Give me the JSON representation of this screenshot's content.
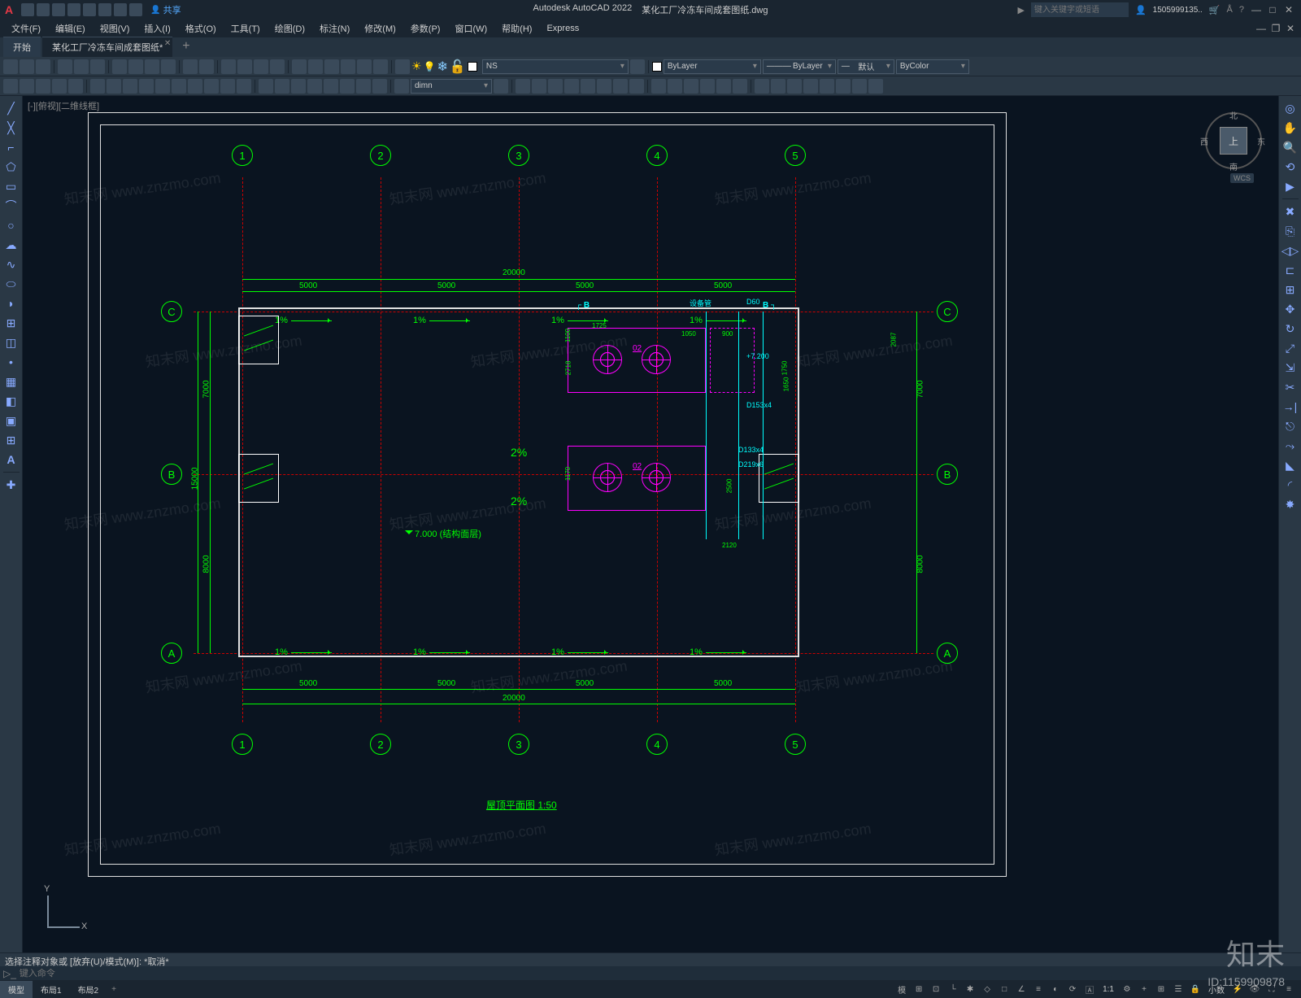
{
  "title_bar": {
    "app_name": "Autodesk AutoCAD 2022",
    "file_name": "某化工厂冷冻车间成套图纸.dwg",
    "search_placeholder": "键入关键字或短语",
    "user": "1505999135..",
    "share": "共享"
  },
  "menu": {
    "items": [
      "文件(F)",
      "编辑(E)",
      "视图(V)",
      "插入(I)",
      "格式(O)",
      "工具(T)",
      "绘图(D)",
      "标注(N)",
      "修改(M)",
      "参数(P)",
      "窗口(W)",
      "帮助(H)",
      "Express"
    ]
  },
  "doc_tabs": {
    "start": "开始",
    "active": "某化工厂冷冻车间成套图纸*"
  },
  "layer_panel": {
    "current_layer": "NS",
    "color": "ByLayer",
    "linetype": "ByLayer",
    "lineweight": "默认",
    "plotcolor": "ByColor"
  },
  "style_panel": {
    "dim_style": "dimn"
  },
  "viewport_label": "[-][俯视][二维线框]",
  "viewcube": {
    "top": "上",
    "n": "北",
    "s": "南",
    "e": "东",
    "w": "西",
    "wcs": "WCS"
  },
  "ucs": {
    "x": "X",
    "y": "Y"
  },
  "drawing": {
    "grid_cols": [
      "1",
      "2",
      "3",
      "4",
      "5"
    ],
    "grid_rows": [
      "A",
      "B",
      "C"
    ],
    "dim_h_top": [
      "5000",
      "5000",
      "5000",
      "5000"
    ],
    "dim_h_top_total": "20000",
    "dim_h_bot": [
      "5000",
      "5000",
      "5000",
      "5000"
    ],
    "dim_h_bot_total": "20000",
    "dim_v_left": [
      "7000",
      "8000"
    ],
    "dim_v_left_total": "15000",
    "dim_v_right": [
      "7000",
      "8000"
    ],
    "slope_top_pct": "1%",
    "slope_bot_pct": "1%",
    "slope_center_pct": "2%",
    "elevation": "7.000 (结构面层)",
    "equip_label": "02",
    "equip_elev": "+7.200",
    "section_b": "B",
    "detail_dim1": "1725",
    "detail_dim2": "2718",
    "detail_dim3": "1100",
    "detail_dim4": "2087",
    "detail_dim5": "2500",
    "detail_dim6": "1650",
    "detail_dim7": "1170",
    "detail_dim8": "900",
    "detail_dim9": "1050",
    "detail_dim10": "1750",
    "detail_dim11": "2120",
    "cyan_note1": "设备管",
    "cyan_note2": "D60",
    "cyan_note3": "D153x4",
    "cyan_note4": "D133x4",
    "cyan_note5": "D219x6",
    "title": "屋顶平面图 1:50"
  },
  "command": {
    "history": "选择注释对象或  [放弃(U)/模式(M)]:  *取消*",
    "placeholder": "键入命令"
  },
  "status": {
    "tabs": [
      "模型",
      "布局1",
      "布局2"
    ],
    "scale": "1:1",
    "right_text": "小数"
  },
  "watermark": {
    "text": "知末网 www.znzmo.com",
    "brand": "知末",
    "id": "ID:1159909878"
  }
}
